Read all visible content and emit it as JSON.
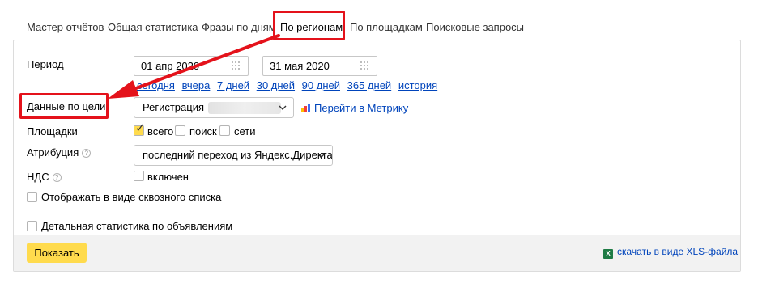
{
  "tabs": [
    {
      "label": "Мастер отчётов"
    },
    {
      "label": "Общая статистика"
    },
    {
      "label": "Фразы по дням"
    },
    {
      "label": "По регионам",
      "active": true
    },
    {
      "label": "По площадкам"
    },
    {
      "label": "Поисковые запросы"
    }
  ],
  "period": {
    "label": "Период",
    "from": "01 апр 2020",
    "to": "31 мая 2020",
    "quick_links": [
      "сегодня",
      "вчера",
      "7 дней",
      "30 дней",
      "90 дней",
      "365 дней",
      "история"
    ]
  },
  "goal": {
    "label": "Данные по цели",
    "value": "Регистрация",
    "metrika_link": "Перейти в Метрику"
  },
  "platforms": {
    "label": "Площадки",
    "options": [
      {
        "label": "всего",
        "checked": true
      },
      {
        "label": "поиск",
        "checked": false
      },
      {
        "label": "сети",
        "checked": false
      }
    ]
  },
  "attribution": {
    "label": "Атрибуция",
    "help": "?",
    "value": "последний переход из Яндекс.Директа"
  },
  "vat": {
    "label": "НДС",
    "help": "?",
    "option": "включен",
    "checked": false
  },
  "flat_list": {
    "label": "Отображать в виде сквозного списка",
    "checked": false
  },
  "detailed": {
    "label": "Детальная статистика по объявлениям",
    "checked": false
  },
  "footer": {
    "show_button": "Показать",
    "xls_link": "скачать в виде XLS-файла"
  },
  "colors": {
    "accent_yellow": "#ffdb4d",
    "link_blue": "#0044bb",
    "highlight_red": "#e4121b"
  }
}
